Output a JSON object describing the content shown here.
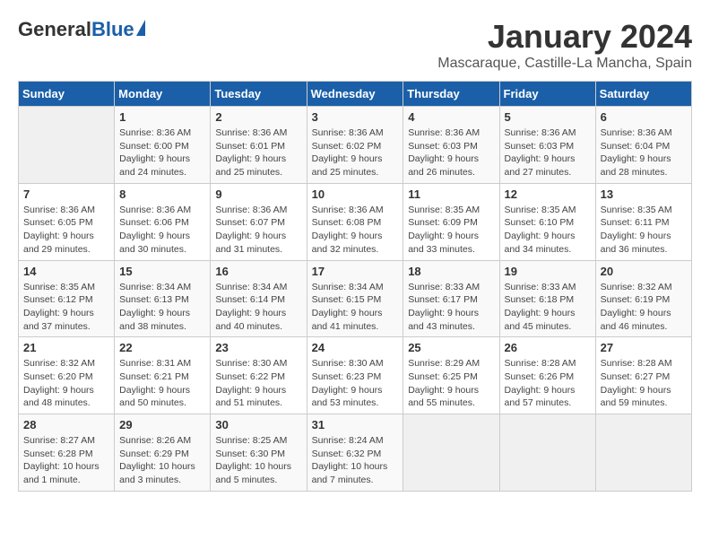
{
  "header": {
    "logo_general": "General",
    "logo_blue": "Blue",
    "month": "January 2024",
    "location": "Mascaraque, Castille-La Mancha, Spain"
  },
  "days": [
    "Sunday",
    "Monday",
    "Tuesday",
    "Wednesday",
    "Thursday",
    "Friday",
    "Saturday"
  ],
  "weeks": [
    [
      {
        "date": "",
        "info": ""
      },
      {
        "date": "1",
        "info": "Sunrise: 8:36 AM\nSunset: 6:00 PM\nDaylight: 9 hours\nand 24 minutes."
      },
      {
        "date": "2",
        "info": "Sunrise: 8:36 AM\nSunset: 6:01 PM\nDaylight: 9 hours\nand 25 minutes."
      },
      {
        "date": "3",
        "info": "Sunrise: 8:36 AM\nSunset: 6:02 PM\nDaylight: 9 hours\nand 25 minutes."
      },
      {
        "date": "4",
        "info": "Sunrise: 8:36 AM\nSunset: 6:03 PM\nDaylight: 9 hours\nand 26 minutes."
      },
      {
        "date": "5",
        "info": "Sunrise: 8:36 AM\nSunset: 6:03 PM\nDaylight: 9 hours\nand 27 minutes."
      },
      {
        "date": "6",
        "info": "Sunrise: 8:36 AM\nSunset: 6:04 PM\nDaylight: 9 hours\nand 28 minutes."
      }
    ],
    [
      {
        "date": "7",
        "info": "Sunrise: 8:36 AM\nSunset: 6:05 PM\nDaylight: 9 hours\nand 29 minutes."
      },
      {
        "date": "8",
        "info": "Sunrise: 8:36 AM\nSunset: 6:06 PM\nDaylight: 9 hours\nand 30 minutes."
      },
      {
        "date": "9",
        "info": "Sunrise: 8:36 AM\nSunset: 6:07 PM\nDaylight: 9 hours\nand 31 minutes."
      },
      {
        "date": "10",
        "info": "Sunrise: 8:36 AM\nSunset: 6:08 PM\nDaylight: 9 hours\nand 32 minutes."
      },
      {
        "date": "11",
        "info": "Sunrise: 8:35 AM\nSunset: 6:09 PM\nDaylight: 9 hours\nand 33 minutes."
      },
      {
        "date": "12",
        "info": "Sunrise: 8:35 AM\nSunset: 6:10 PM\nDaylight: 9 hours\nand 34 minutes."
      },
      {
        "date": "13",
        "info": "Sunrise: 8:35 AM\nSunset: 6:11 PM\nDaylight: 9 hours\nand 36 minutes."
      }
    ],
    [
      {
        "date": "14",
        "info": "Sunrise: 8:35 AM\nSunset: 6:12 PM\nDaylight: 9 hours\nand 37 minutes."
      },
      {
        "date": "15",
        "info": "Sunrise: 8:34 AM\nSunset: 6:13 PM\nDaylight: 9 hours\nand 38 minutes."
      },
      {
        "date": "16",
        "info": "Sunrise: 8:34 AM\nSunset: 6:14 PM\nDaylight: 9 hours\nand 40 minutes."
      },
      {
        "date": "17",
        "info": "Sunrise: 8:34 AM\nSunset: 6:15 PM\nDaylight: 9 hours\nand 41 minutes."
      },
      {
        "date": "18",
        "info": "Sunrise: 8:33 AM\nSunset: 6:17 PM\nDaylight: 9 hours\nand 43 minutes."
      },
      {
        "date": "19",
        "info": "Sunrise: 8:33 AM\nSunset: 6:18 PM\nDaylight: 9 hours\nand 45 minutes."
      },
      {
        "date": "20",
        "info": "Sunrise: 8:32 AM\nSunset: 6:19 PM\nDaylight: 9 hours\nand 46 minutes."
      }
    ],
    [
      {
        "date": "21",
        "info": "Sunrise: 8:32 AM\nSunset: 6:20 PM\nDaylight: 9 hours\nand 48 minutes."
      },
      {
        "date": "22",
        "info": "Sunrise: 8:31 AM\nSunset: 6:21 PM\nDaylight: 9 hours\nand 50 minutes."
      },
      {
        "date": "23",
        "info": "Sunrise: 8:30 AM\nSunset: 6:22 PM\nDaylight: 9 hours\nand 51 minutes."
      },
      {
        "date": "24",
        "info": "Sunrise: 8:30 AM\nSunset: 6:23 PM\nDaylight: 9 hours\nand 53 minutes."
      },
      {
        "date": "25",
        "info": "Sunrise: 8:29 AM\nSunset: 6:25 PM\nDaylight: 9 hours\nand 55 minutes."
      },
      {
        "date": "26",
        "info": "Sunrise: 8:28 AM\nSunset: 6:26 PM\nDaylight: 9 hours\nand 57 minutes."
      },
      {
        "date": "27",
        "info": "Sunrise: 8:28 AM\nSunset: 6:27 PM\nDaylight: 9 hours\nand 59 minutes."
      }
    ],
    [
      {
        "date": "28",
        "info": "Sunrise: 8:27 AM\nSunset: 6:28 PM\nDaylight: 10 hours\nand 1 minute."
      },
      {
        "date": "29",
        "info": "Sunrise: 8:26 AM\nSunset: 6:29 PM\nDaylight: 10 hours\nand 3 minutes."
      },
      {
        "date": "30",
        "info": "Sunrise: 8:25 AM\nSunset: 6:30 PM\nDaylight: 10 hours\nand 5 minutes."
      },
      {
        "date": "31",
        "info": "Sunrise: 8:24 AM\nSunset: 6:32 PM\nDaylight: 10 hours\nand 7 minutes."
      },
      {
        "date": "",
        "info": ""
      },
      {
        "date": "",
        "info": ""
      },
      {
        "date": "",
        "info": ""
      }
    ]
  ]
}
